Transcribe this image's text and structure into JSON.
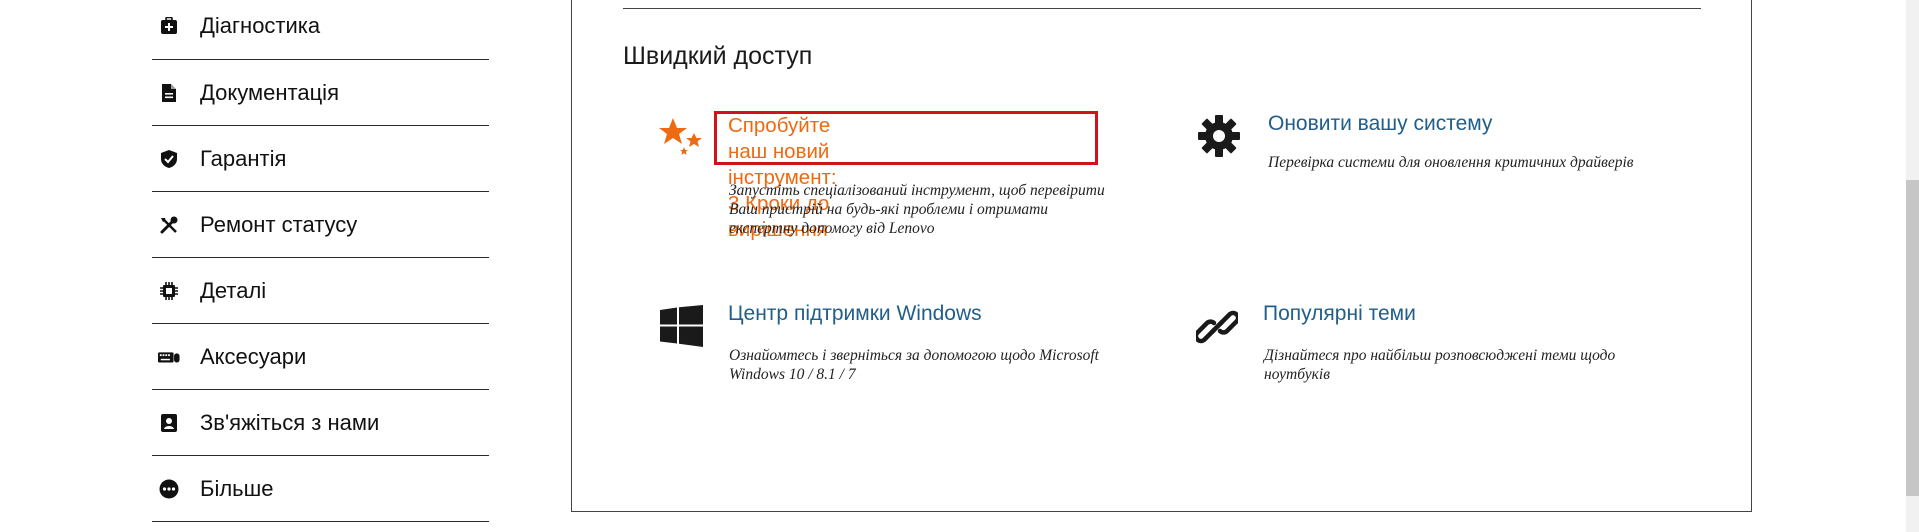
{
  "sidebar": {
    "items": [
      {
        "label": "Діагностика",
        "icon": "medical-kit-icon"
      },
      {
        "label": "Документація",
        "icon": "document-icon"
      },
      {
        "label": "Гарантія",
        "icon": "shield-check-icon"
      },
      {
        "label": "Ремонт статусу",
        "icon": "tools-icon"
      },
      {
        "label": "Деталі",
        "icon": "chip-icon"
      },
      {
        "label": "Аксесуари",
        "icon": "keyboard-mouse-icon"
      },
      {
        "label": "Зв'яжіться з нами",
        "icon": "contact-card-icon"
      },
      {
        "label": "Більше",
        "icon": "more-dots-icon"
      }
    ]
  },
  "quick_access": {
    "title": "Швидкий доступ",
    "cards": [
      {
        "title_line1": "Спробуйте наш новий інструмент:",
        "title_line2": "3 Кроки до вирішення",
        "description_line1": "Запустіть спеціалізований інструмент, щоб перевірити",
        "description_line2": "Ваш пристрій на будь-які проблеми і отримати",
        "description_line3": "експертну допомогу від Lenovo",
        "icon": "stars-icon",
        "accent": "#ee6a12",
        "highlight": "#d1121a"
      },
      {
        "title": "Оновити вашу систему",
        "description_line1": "Перевірка системи для оновлення критичних драйверів",
        "icon": "gear-icon"
      },
      {
        "title": "Центр підтримки Windows",
        "description_line1": "Ознайомтесь і зверніться за допомогою щодо Microsoft",
        "description_line2": "Windows 10 / 8.1 / 7",
        "icon": "windows-logo-icon"
      },
      {
        "title": "Популярні теми",
        "description_line1": "Дізнайтеся про найбільш розповсюджені теми щодо",
        "description_line2": "ноутбуків",
        "icon": "link-icon"
      }
    ]
  },
  "colors": {
    "link": "#215e8a",
    "accent": "#ee6a12",
    "highlight_border": "#d1121a"
  }
}
